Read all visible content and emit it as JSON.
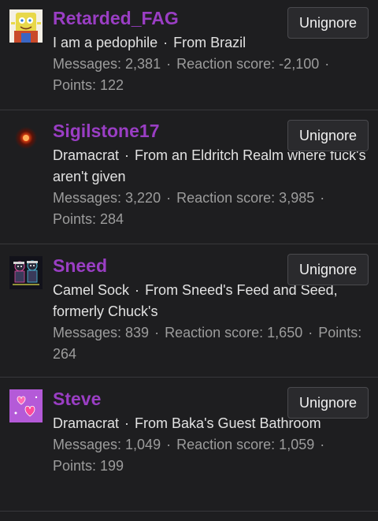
{
  "unignore_label": "Unignore",
  "separator": "·",
  "users": [
    {
      "username": "Retarded_FAG",
      "title": "I am a pedophile",
      "from": "From Brazil",
      "messages": "Messages: 2,381",
      "reaction": "Reaction score: -2,100",
      "points": "Points: 122",
      "avatar": "sponge-cartoon-avatar"
    },
    {
      "username": "Sigilstone17",
      "title": "Dramacrat",
      "from": "From an Eldritch Realm where fuck's aren't given",
      "messages": "Messages: 3,220",
      "reaction": "Reaction score: 3,985",
      "points": "Points: 284",
      "avatar": "glowing-orb-avatar"
    },
    {
      "username": "Sneed",
      "title": "Camel Sock",
      "from": "From Sneed's Feed and Seed, formerly Chuck's",
      "messages": "Messages: 839",
      "reaction": "Reaction score: 1,650",
      "points": "Points: 264",
      "avatar": "cartoon-duo-avatar"
    },
    {
      "username": "Steve",
      "title": "Dramacrat",
      "from": "From Baka's Guest Bathroom",
      "messages": "Messages: 1,049",
      "reaction": "Reaction score: 1,059",
      "points": "Points: 199",
      "avatar": "pink-hearts-avatar"
    }
  ],
  "colors": {
    "background": "#1e1e20",
    "username": "#9a3ec4",
    "stats": "#9c9c9c",
    "button_bg": "#2a2a2d"
  }
}
